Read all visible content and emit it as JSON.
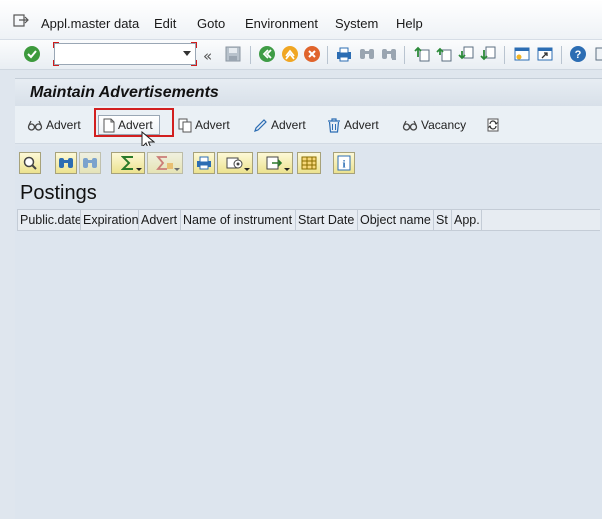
{
  "menu": {
    "items": [
      "Appl.master data",
      "Edit",
      "Goto",
      "Environment",
      "System",
      "Help"
    ]
  },
  "toolbar": {
    "command_value": "",
    "icons": [
      "enter-icon",
      "save-icon",
      "back-icon",
      "exit-icon",
      "cancel-icon",
      "print-icon",
      "find-icon",
      "find-next-icon",
      "first-page-icon",
      "previous-page-icon",
      "next-page-icon",
      "last-page-icon",
      "new-session-icon",
      "shortcut-icon",
      "help-icon"
    ]
  },
  "title": "Maintain Advertisements",
  "app_toolbar": {
    "buttons": [
      {
        "label": "Advert",
        "icon": "glasses-icon"
      },
      {
        "label": "Advert",
        "icon": "create-document-icon"
      },
      {
        "label": "Advert",
        "icon": "copy-icon"
      },
      {
        "label": "Advert",
        "icon": "pencil-icon"
      },
      {
        "label": "Advert",
        "icon": "trash-icon"
      },
      {
        "label": "Vacancy",
        "icon": "glasses-icon"
      },
      {
        "label": "",
        "icon": "refresh-icon"
      }
    ]
  },
  "alv_toolbar": {
    "icons": [
      "details-icon",
      "find-icon",
      "find-next-icon",
      "sum-icon",
      "subtotal-icon",
      "print-preview-icon",
      "views-icon",
      "export-icon",
      "layout-icon",
      "info-icon"
    ]
  },
  "grid": {
    "title": "Postings",
    "columns": [
      "Public.date",
      "Expiration",
      "Advert",
      "Name of instrument",
      "Start Date",
      "Object name",
      "St",
      "App."
    ]
  }
}
